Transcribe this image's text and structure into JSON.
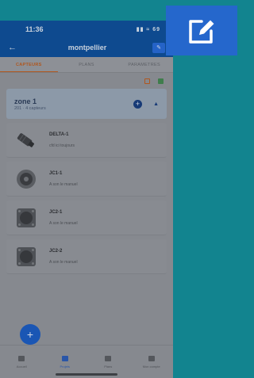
{
  "status": {
    "time": "11:36",
    "icons": "▮▮ ≈ 69"
  },
  "header": {
    "title": "montpellier"
  },
  "tabs": [
    {
      "label": "CAPTEURS",
      "active": true
    },
    {
      "label": "PLANS",
      "active": false
    },
    {
      "label": "PARAMETRES",
      "active": false
    }
  ],
  "zone": {
    "title": "zone 1",
    "subtitle": "201 · 4 capteurs"
  },
  "sensors": [
    {
      "name": "DELTA-1",
      "desc": "cfd ici toujours",
      "icon": "delta-sensor-icon"
    },
    {
      "name": "JC1-1",
      "desc": "A son le manuel",
      "icon": "round-sensor-icon"
    },
    {
      "name": "JC2-1",
      "desc": "A son le manuel",
      "icon": "square-sensor-icon"
    },
    {
      "name": "JC2-2",
      "desc": "A son le manuel",
      "icon": "square-sensor-icon"
    }
  ],
  "nav": [
    {
      "label": "Accueil",
      "active": false
    },
    {
      "label": "Projets",
      "active": true
    },
    {
      "label": "Plans",
      "active": false
    },
    {
      "label": "Mon compte",
      "active": false
    }
  ],
  "colors": {
    "accent": "#2567cc",
    "background": "#12848f"
  }
}
